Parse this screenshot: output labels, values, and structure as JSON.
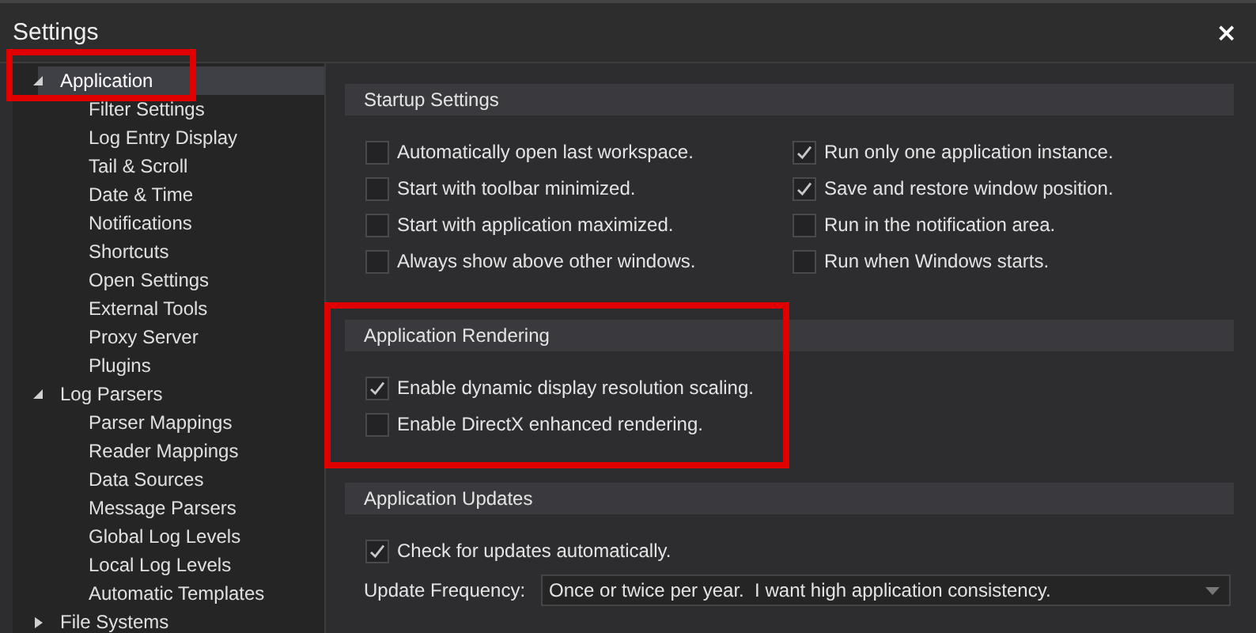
{
  "window": {
    "title": "Settings",
    "close": "×"
  },
  "tree": [
    {
      "label": "Application",
      "expanded": true,
      "selected": true,
      "children": [
        {
          "label": "Filter Settings",
          "selected": false
        },
        {
          "label": "Log Entry Display",
          "selected": false
        },
        {
          "label": "Tail & Scroll",
          "selected": false
        },
        {
          "label": "Date & Time",
          "selected": false
        },
        {
          "label": "Notifications",
          "selected": false
        },
        {
          "label": "Shortcuts",
          "selected": false
        },
        {
          "label": "Open Settings",
          "selected": false
        },
        {
          "label": "External Tools",
          "selected": false
        },
        {
          "label": "Proxy Server",
          "selected": false
        },
        {
          "label": "Plugins",
          "selected": false
        }
      ]
    },
    {
      "label": "Log Parsers",
      "expanded": true,
      "selected": false,
      "children": [
        {
          "label": "Parser Mappings",
          "selected": false
        },
        {
          "label": "Reader Mappings",
          "selected": false
        },
        {
          "label": "Data Sources",
          "selected": false
        },
        {
          "label": "Message Parsers",
          "selected": false
        },
        {
          "label": "Global Log Levels",
          "selected": false
        },
        {
          "label": "Local Log Levels",
          "selected": false
        },
        {
          "label": "Automatic Templates",
          "selected": false
        }
      ]
    },
    {
      "label": "File Systems",
      "expanded": false,
      "selected": false
    }
  ],
  "sections": [
    {
      "title": "Startup Settings",
      "columns": [
        [
          {
            "label": "Automatically open last workspace.",
            "checked": false
          },
          {
            "label": "Start with toolbar minimized.",
            "checked": false
          },
          {
            "label": "Start with application maximized.",
            "checked": false
          },
          {
            "label": "Always show above other windows.",
            "checked": false
          }
        ],
        [
          {
            "label": "Run only one application instance.",
            "checked": true
          },
          {
            "label": "Save and restore window position.",
            "checked": true
          },
          {
            "label": "Run in the notification area.",
            "checked": false
          },
          {
            "label": "Run when Windows starts.",
            "checked": false
          }
        ]
      ]
    },
    {
      "title": "Application Rendering",
      "columns": [
        [
          {
            "label": "Enable dynamic display resolution scaling.",
            "checked": true
          },
          {
            "label": "Enable DirectX enhanced rendering.",
            "checked": false
          }
        ]
      ]
    },
    {
      "title": "Application Updates",
      "columns": [
        [
          {
            "label": "Check for updates automatically.",
            "checked": true
          }
        ]
      ],
      "dropdown": {
        "label": "Update Frequency:",
        "value": "Once or twice per year.  I want high application consistency."
      }
    }
  ]
}
